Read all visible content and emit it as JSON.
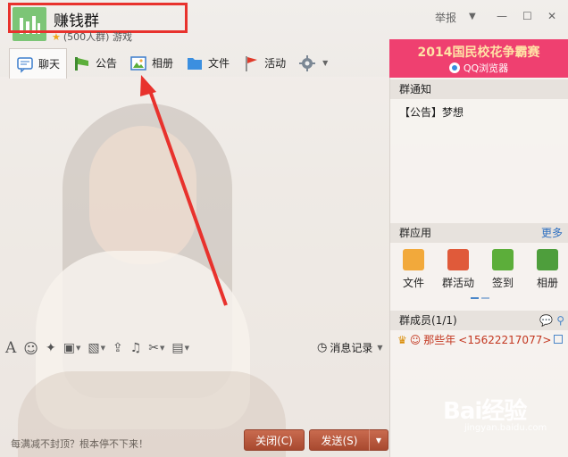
{
  "window": {
    "group_name": "赚钱群",
    "group_sub": "(500人群) 游戏",
    "report_label": "举报",
    "controls": [
      "▼",
      "—",
      "☐",
      "✕"
    ]
  },
  "tabs": [
    {
      "label": "聊天"
    },
    {
      "label": "公告"
    },
    {
      "label": "相册"
    },
    {
      "label": "文件"
    },
    {
      "label": "活动"
    }
  ],
  "ad": {
    "title": "2014国民校花争霸赛",
    "sub": "QQ浏览器"
  },
  "right_panel": {
    "notice_header": "群通知",
    "notice_text": "【公告】梦想",
    "apps_header": "群应用",
    "apps_more": "更多",
    "apps": [
      {
        "label": "文件",
        "color": "#f2a93b"
      },
      {
        "label": "群活动",
        "color": "#e05a3a"
      },
      {
        "label": "签到",
        "color": "#5cae3a"
      },
      {
        "label": "相册",
        "color": "#4e9e3c"
      }
    ],
    "members_header": "群成员(1/1)",
    "member_name": "那些年",
    "member_qq": "<15622217077>"
  },
  "chat": {
    "history_label": "消息记录",
    "tip_text": "每满减不封顶？根本停不下来！",
    "close_label": "关闭(C)",
    "send_label": "发送(S)"
  },
  "watermark": {
    "main": "Bai经验",
    "sub": "jingyan.baidu.com"
  },
  "colors": {
    "highlight_red": "#e8322d",
    "ad_pink": "#ef4070",
    "button_brown": "#b5543a"
  }
}
